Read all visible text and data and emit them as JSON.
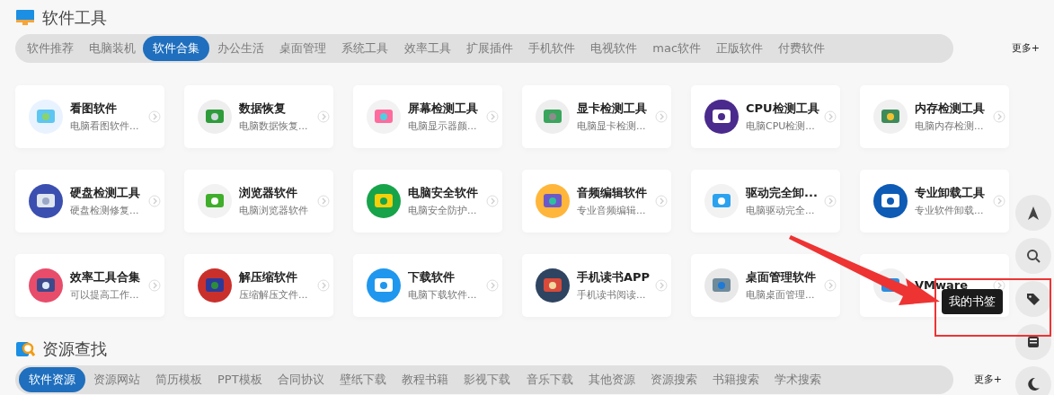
{
  "sections": [
    {
      "title": "软件工具",
      "tabs": [
        {
          "label": "软件推荐",
          "selected": false
        },
        {
          "label": "电脑装机",
          "selected": false
        },
        {
          "label": "软件合集",
          "selected": true
        },
        {
          "label": "办公生活",
          "selected": false
        },
        {
          "label": "桌面管理",
          "selected": false
        },
        {
          "label": "系统工具",
          "selected": false
        },
        {
          "label": "效率工具",
          "selected": false
        },
        {
          "label": "扩展插件",
          "selected": false
        },
        {
          "label": "手机软件",
          "selected": false
        },
        {
          "label": "电视软件",
          "selected": false
        },
        {
          "label": "mac软件",
          "selected": false
        },
        {
          "label": "正版软件",
          "selected": false
        },
        {
          "label": "付费软件",
          "selected": false
        }
      ],
      "more": "更多+",
      "cards": [
        {
          "title": "看图软件",
          "subtitle": "电脑看图软件..."
        },
        {
          "title": "数据恢复",
          "subtitle": "电脑数据恢复..."
        },
        {
          "title": "屏幕检测工具",
          "subtitle": "电脑显示器颜..."
        },
        {
          "title": "显卡检测工具",
          "subtitle": "电脑显卡检测..."
        },
        {
          "title": "CPU检测工具",
          "subtitle": "电脑CPU检测..."
        },
        {
          "title": "内存检测工具",
          "subtitle": "电脑内存检测..."
        },
        {
          "title": "硬盘检测工具",
          "subtitle": "硬盘检测修复..."
        },
        {
          "title": "浏览器软件",
          "subtitle": "电脑浏览器软件"
        },
        {
          "title": "电脑安全软件",
          "subtitle": "电脑安全防护..."
        },
        {
          "title": "音频编辑软件",
          "subtitle": "专业音频编辑..."
        },
        {
          "title": "驱动完全卸...",
          "subtitle": "电脑驱动完全..."
        },
        {
          "title": "专业卸载工具",
          "subtitle": "专业软件卸载..."
        },
        {
          "title": "效率工具合集",
          "subtitle": "可以提高工作..."
        },
        {
          "title": "解压缩软件",
          "subtitle": "压缩解压文件..."
        },
        {
          "title": "下载软件",
          "subtitle": "电脑下载软件..."
        },
        {
          "title": "手机读书APP",
          "subtitle": "手机读书阅读..."
        },
        {
          "title": "桌面管理软件",
          "subtitle": "电脑桌面管理..."
        },
        {
          "title": "VMware"
        }
      ]
    },
    {
      "title": "资源查找",
      "tabs": [
        {
          "label": "软件资源",
          "selected": true
        },
        {
          "label": "资源网站",
          "selected": false
        },
        {
          "label": "简历模板",
          "selected": false
        },
        {
          "label": "PPT模板",
          "selected": false
        },
        {
          "label": "合同协议",
          "selected": false
        },
        {
          "label": "壁纸下载",
          "selected": false
        },
        {
          "label": "教程书籍",
          "selected": false
        },
        {
          "label": "影视下载",
          "selected": false
        },
        {
          "label": "音乐下载",
          "selected": false
        },
        {
          "label": "其他资源",
          "selected": false
        },
        {
          "label": "资源搜索",
          "selected": false
        },
        {
          "label": "书籍搜索",
          "selected": false
        },
        {
          "label": "学术搜索",
          "selected": false
        }
      ],
      "more": "更多+"
    }
  ],
  "tooltip": "我的书签"
}
